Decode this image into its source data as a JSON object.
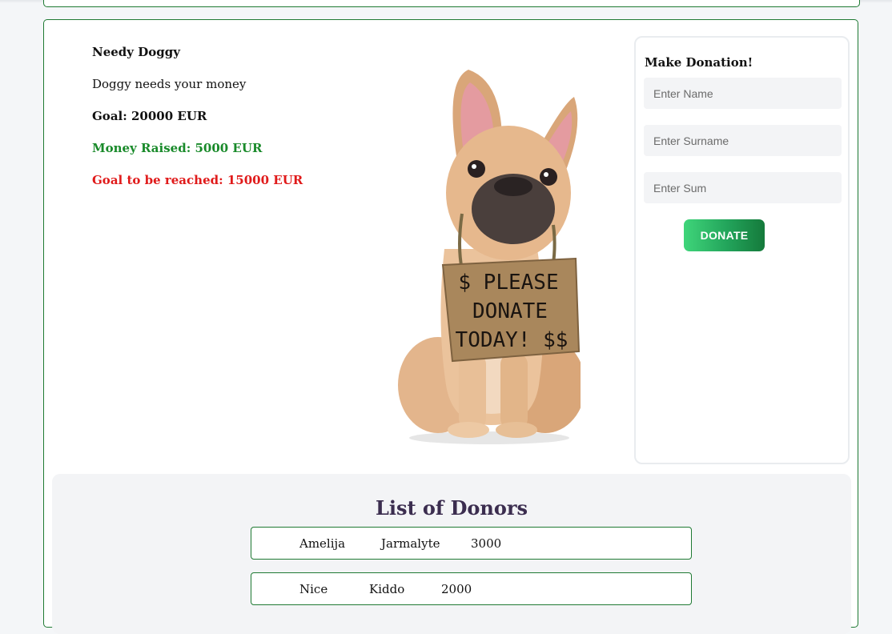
{
  "campaign": {
    "name": "Needy Doggy",
    "description": "Doggy needs your money",
    "goal": "Goal: 20000 EUR",
    "raised": "Money Raised: 5000 EUR",
    "remaining": "Goal to be reached: 15000 EUR",
    "image": {
      "sign_lines": [
        "$ PLEASE",
        "DONATE",
        "TODAY! $$"
      ]
    }
  },
  "donation_form": {
    "title": "Make Donation!",
    "name_placeholder": "Enter Name",
    "surname_placeholder": "Enter Surname",
    "sum_placeholder": "Enter Sum",
    "button_label": "DONATE"
  },
  "donors": {
    "title": "List of Donors",
    "rows": [
      {
        "name": "Amelija",
        "surname": "Jarmalyte",
        "sum": "3000"
      },
      {
        "name": "Nice",
        "surname": "Kiddo",
        "sum": "2000"
      }
    ]
  },
  "colors": {
    "border": "#1f7a33",
    "raised": "#198a2a",
    "remaining": "#e01a1a",
    "button_start": "#3fd57a",
    "button_end": "#157a3b",
    "donors_title": "#3b2d4f"
  }
}
